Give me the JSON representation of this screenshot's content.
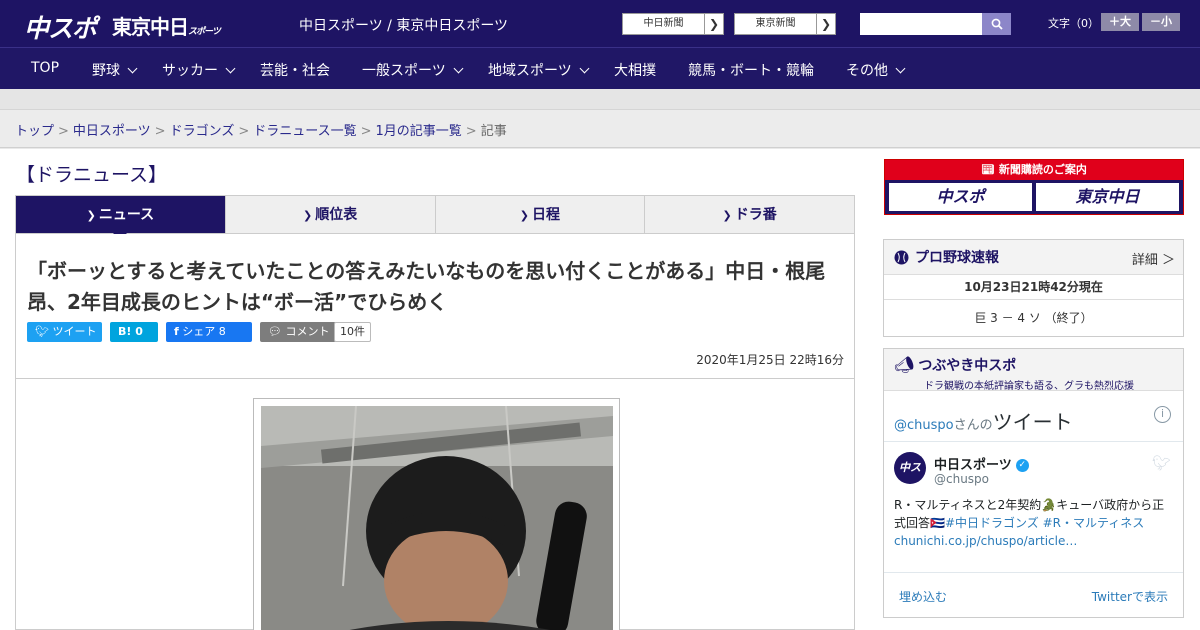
{
  "header": {
    "logo_chuspo": "中スポ",
    "logo_tokyo": "東京中日",
    "logo_tokyo_sub": "スポーツ",
    "site_name": "中日スポーツ / 東京中日スポーツ",
    "ext_links": [
      "中日新聞",
      "東京新聞"
    ],
    "search_placeholder": "",
    "font_size_label": "文字（0）",
    "font_bigger": "＋大",
    "font_smaller": "－小"
  },
  "nav": {
    "items": [
      {
        "label": "TOP",
        "has_menu": false
      },
      {
        "label": "野球",
        "has_menu": true
      },
      {
        "label": "サッカー",
        "has_menu": true
      },
      {
        "label": "芸能・社会",
        "has_menu": false
      },
      {
        "label": "一般スポーツ",
        "has_menu": true
      },
      {
        "label": "地域スポーツ",
        "has_menu": true
      },
      {
        "label": "大相撲",
        "has_menu": false
      },
      {
        "label": "競馬・ボート・競輪",
        "has_menu": false
      },
      {
        "label": "その他",
        "has_menu": true
      }
    ]
  },
  "breadcrumb": {
    "items": [
      "トップ",
      "中日スポーツ",
      "ドラゴンズ",
      "ドラニュース一覧",
      "1月の記事一覧"
    ],
    "current": "記事"
  },
  "section": {
    "title": "【ドラニュース】",
    "tabs": [
      "ニュース",
      "順位表",
      "日程",
      "ドラ番"
    ],
    "active_tab": 0
  },
  "article": {
    "headline": "「ボーッとすると考えていたことの答えみたいなものを思い付くことがある」中日・根尾昂、2年目成長のヒントは“ボー活”でひらめく",
    "share": {
      "tweet": "ツイート",
      "hatena": "B! 0",
      "facebook": "シェア 8",
      "comment": "コメント",
      "comment_count": "10件"
    },
    "date": "2020年1月25日 22時16分"
  },
  "sidebar": {
    "ad": {
      "title": "新聞購読のご案内",
      "buttons": [
        "中スポ",
        "東京中日"
      ]
    },
    "baseball": {
      "title": "プロ野球速報",
      "detail": "詳細 ＞",
      "time": "10月23日21時42分現在",
      "score": "巨 3 － 4 ソ （終了）"
    },
    "tweets": {
      "title": "つぶやき中スポ",
      "subtitle": "ドラ観戦の本紙評論家も語る、グラも熱烈応援",
      "account": "@chuspo",
      "account_suffix": "さんの",
      "heading": "ツイート",
      "tweet": {
        "name": "中日スポーツ",
        "handle": "@chuspo",
        "text_plain": "R・マルティネスと2年契約🐊キューバ政府から正式回答🇨🇺",
        "hashtags": "#中日ドラゴンズ #R・マルティネス",
        "link": "chunichi.co.jp/chuspo/article…"
      },
      "embed": "埋め込む",
      "view_on": "Twitterで表示"
    }
  },
  "colors": {
    "brand_navy": "#1e1464",
    "accent_red": "#e0001b"
  }
}
